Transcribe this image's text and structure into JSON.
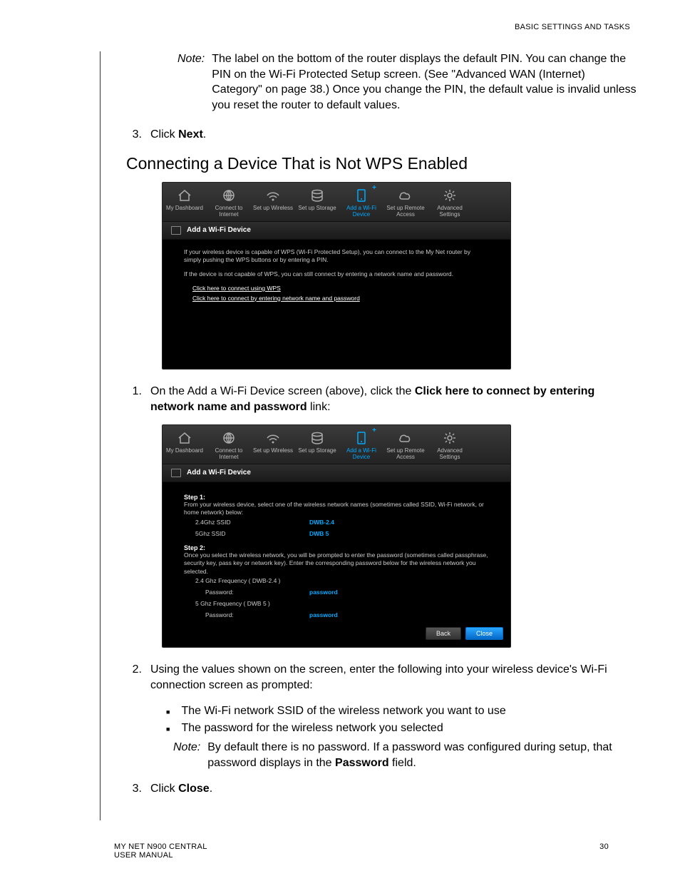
{
  "header_section": "BASIC SETTINGS AND TASKS",
  "note1": {
    "label": "Note:",
    "body": "The label on the bottom of the router displays the default PIN. You can change the PIN on the Wi-Fi Protected Setup screen. (See \"Advanced WAN (Internet) Category\" on page 38.) Once you change the PIN, the default value is invalid unless you reset the router to default values."
  },
  "pre_step": {
    "num": "3.",
    "pre": "Click ",
    "bold": "Next",
    "post": "."
  },
  "heading": "Connecting a Device That is Not WPS Enabled",
  "router_nav": [
    {
      "label": "My Dashboard",
      "icon": "home"
    },
    {
      "label": "Connect to Internet",
      "icon": "globe"
    },
    {
      "label": "Set up Wireless",
      "icon": "wifi"
    },
    {
      "label": "Set up Storage",
      "icon": "disks"
    },
    {
      "label": "Add a Wi-Fi Device",
      "icon": "device",
      "active": true,
      "plus": true
    },
    {
      "label": "Set up Remote Access",
      "icon": "cloud"
    },
    {
      "label": "Advanced Settings",
      "icon": "gear"
    }
  ],
  "panel_title": "Add a Wi-Fi Device",
  "screen1": {
    "p1": "If your wireless device is capable of WPS (Wi-Fi Protected Setup), you can connect to the My Net router by simply pushing the WPS buttons or by entering a PIN.",
    "p2": "If the device is not capable of WPS, you can still connect by entering a network name and password.",
    "link1": "Click here to connect using WPS",
    "link2": "Click here to connect by entering network name and password"
  },
  "step1": {
    "num": "1.",
    "pre": "On the Add a Wi-Fi Device screen (above), click the ",
    "bold": "Click here to connect by entering network name and password",
    "post": " link:"
  },
  "screen2": {
    "step1_h": "Step 1:",
    "step1_t": "From your wireless device, select one of the wireless network names (sometimes called SSID, Wi-Fi network, or home network) below:",
    "ssid24_k": "2.4Ghz SSID",
    "ssid24_v": "DWB-2.4",
    "ssid5_k": "5Ghz SSID",
    "ssid5_v": "DWB 5",
    "step2_h": "Step 2:",
    "step2_t": "Once you select the wireless network, you will be prompted to enter the password (sometimes called passphrase, security key, pass key or network key). Enter the corresponding password below for the wireless network you selected.",
    "f24": "2.4 Ghz Frequency ( DWB-2.4 )",
    "pwk": "Password:",
    "pwv": "password",
    "f5": "5 Ghz Frequency ( DWB 5 )",
    "back": "Back",
    "close": "Close"
  },
  "step2": {
    "num": "2.",
    "text": "Using the values shown on the screen, enter the following into your wireless device's Wi-Fi connection screen as prompted:"
  },
  "bullets": [
    "The Wi-Fi network SSID of the wireless network you want to use",
    "The password for the wireless network you selected"
  ],
  "note2": {
    "label": "Note:",
    "pre": "By default there is no password. If a password was configured during setup, that password displays in the ",
    "bold": "Password",
    "post": " field."
  },
  "step3": {
    "num": "3.",
    "pre": "Click ",
    "bold": "Close",
    "post": "."
  },
  "footer_left_1": "MY NET N900 CENTRAL",
  "footer_left_2": "USER MANUAL",
  "footer_page": "30"
}
